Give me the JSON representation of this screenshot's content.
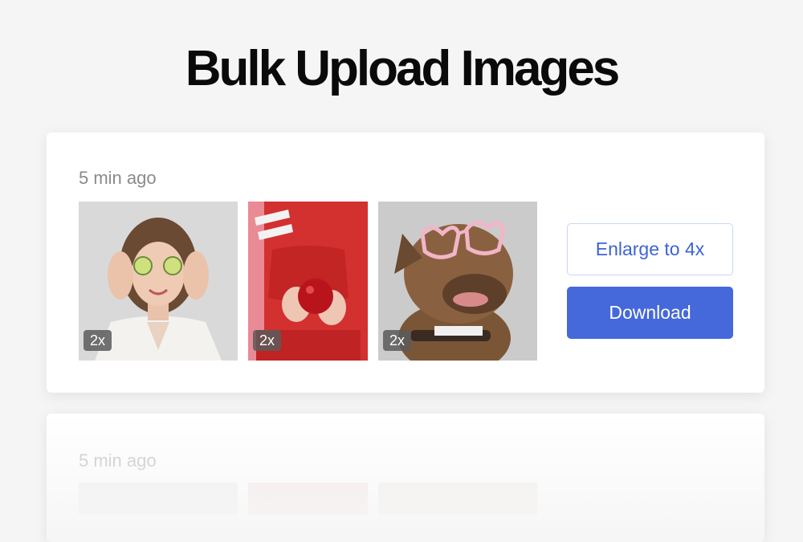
{
  "page": {
    "title": "Bulk Upload Images"
  },
  "batches": [
    {
      "timestamp": "5 min ago",
      "images": [
        {
          "subject": "woman-with-cucumber-slices",
          "scale_badge": "2x"
        },
        {
          "subject": "person-holding-apple",
          "scale_badge": "2x"
        },
        {
          "subject": "dog-with-heart-glasses",
          "scale_badge": "2x"
        }
      ],
      "actions": {
        "enlarge_label": "Enlarge to 4x",
        "download_label": "Download"
      }
    },
    {
      "timestamp": "5 min ago"
    }
  ],
  "colors": {
    "accent": "#4568db",
    "accent_text": "#3d63d6",
    "background": "#f5f5f5",
    "card": "#ffffff"
  }
}
